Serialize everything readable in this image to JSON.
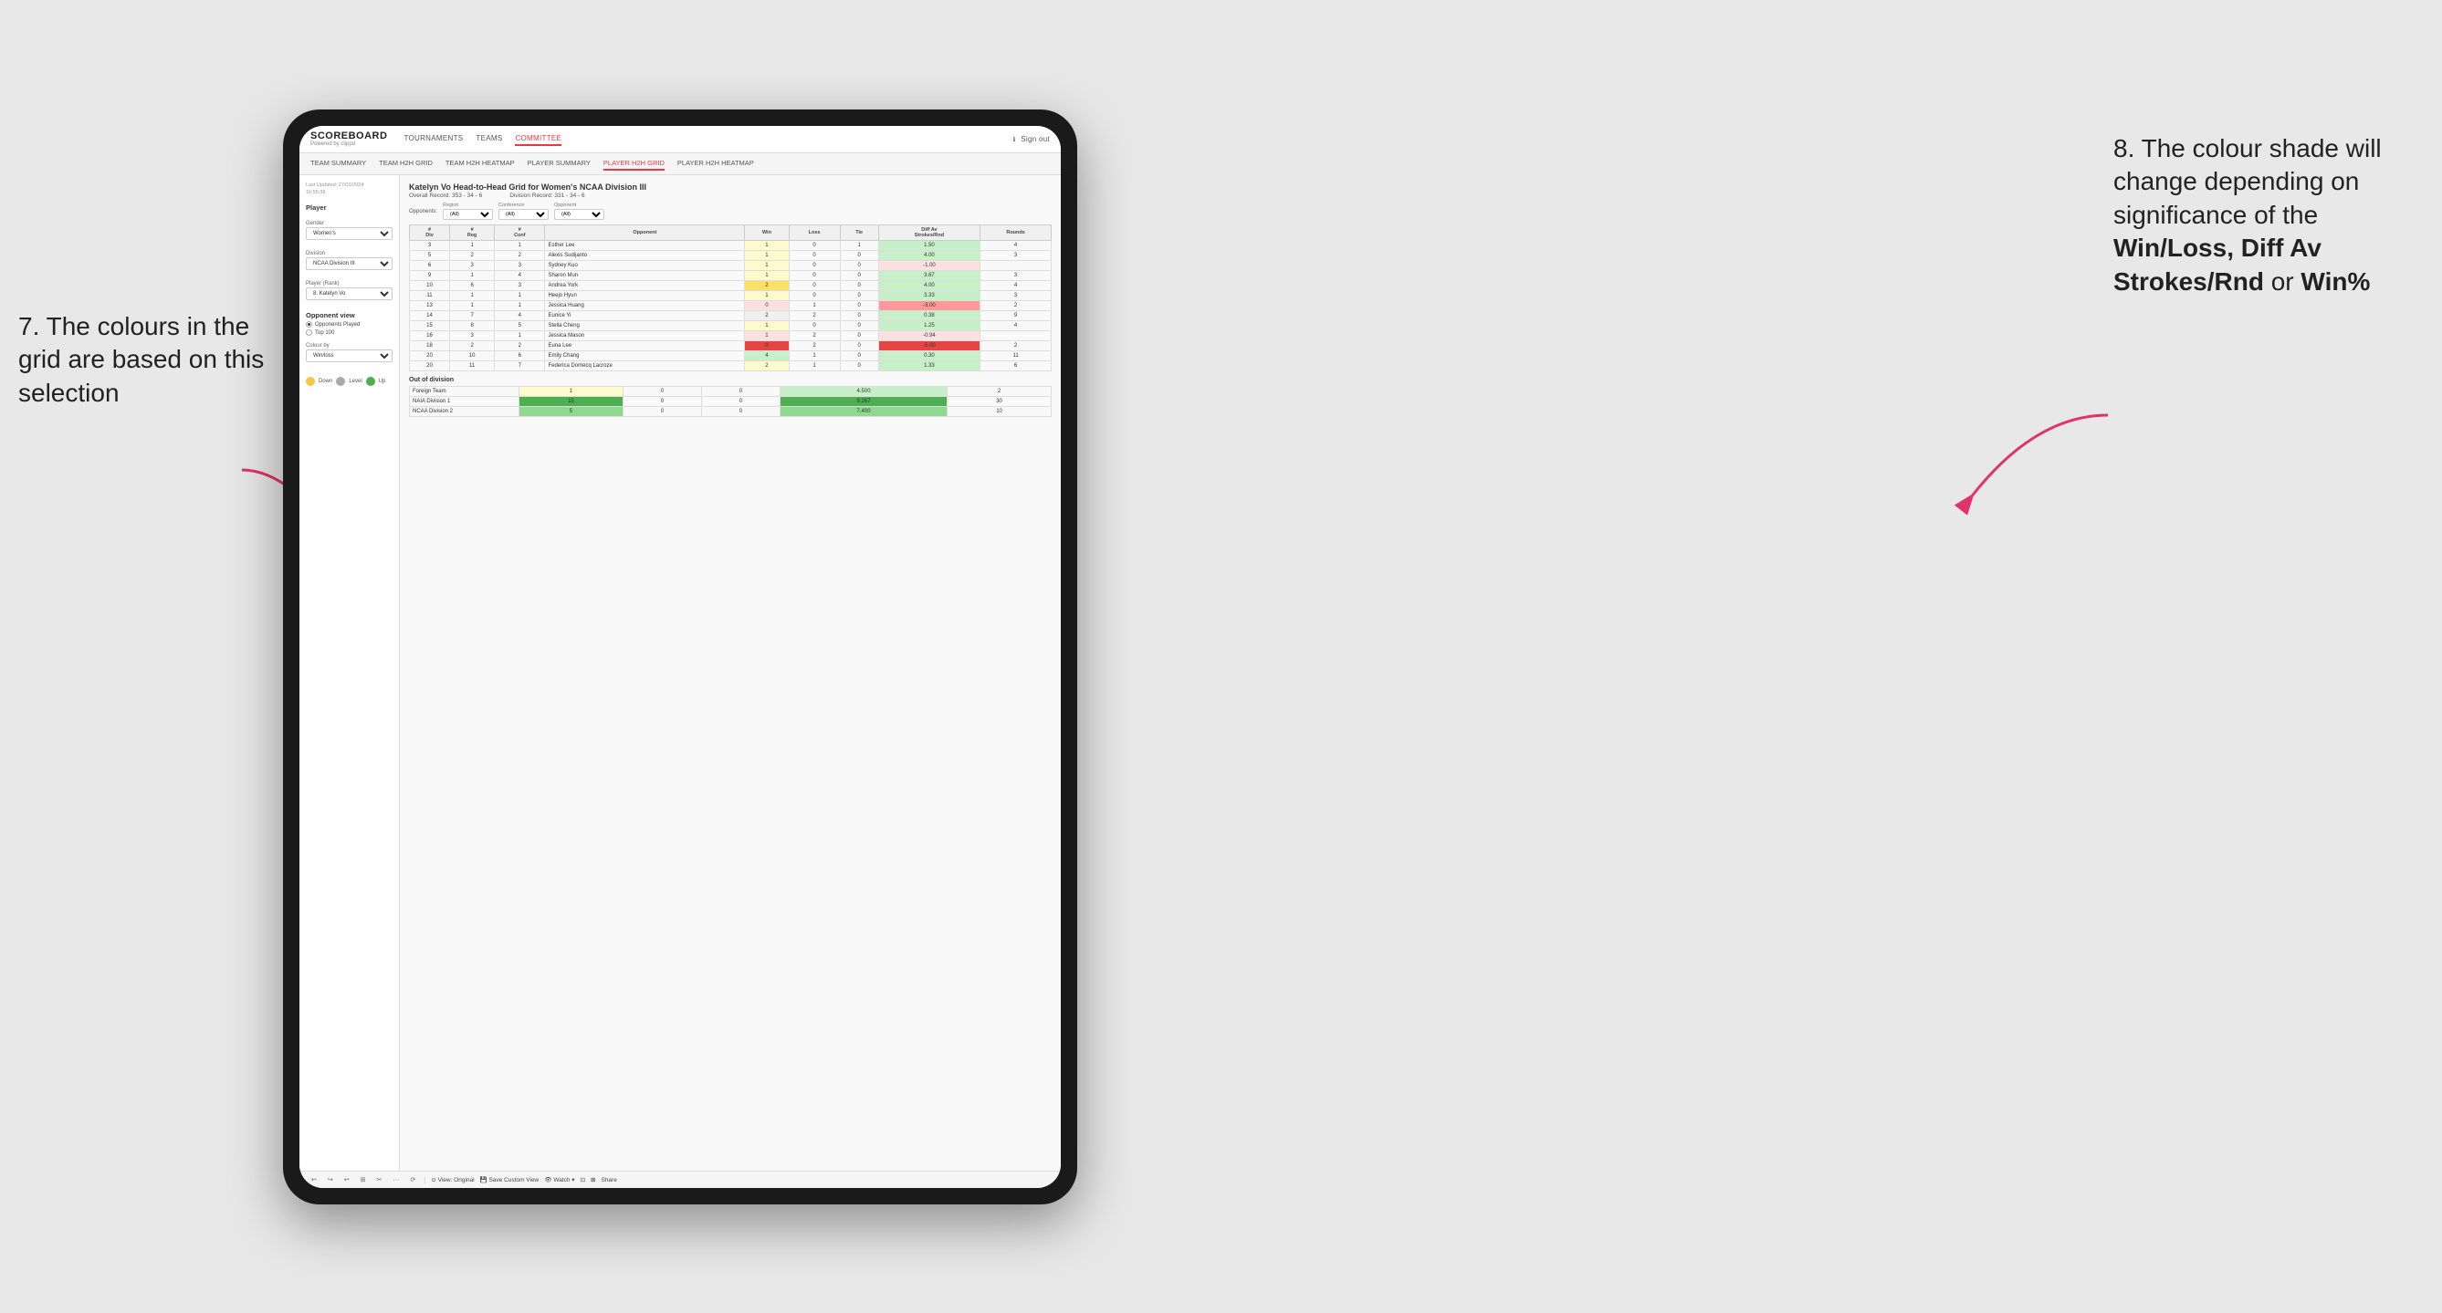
{
  "annotations": {
    "left_title": "7. The colours in the grid are based on this selection",
    "right_title": "8. The colour shade will change depending on significance of the",
    "right_bold1": "Win/Loss, Diff Av Strokes/Rnd",
    "right_text2": "or",
    "right_bold2": "Win%"
  },
  "nav": {
    "logo": "SCOREBOARD",
    "logo_sub": "Powered by clippd",
    "links": [
      "TOURNAMENTS",
      "TEAMS",
      "COMMITTEE"
    ],
    "active_link": "COMMITTEE",
    "right_links": [
      "Sign out"
    ]
  },
  "sub_nav": {
    "links": [
      "TEAM SUMMARY",
      "TEAM H2H GRID",
      "TEAM H2H HEATMAP",
      "PLAYER SUMMARY",
      "PLAYER H2H GRID",
      "PLAYER H2H HEATMAP"
    ],
    "active": "PLAYER H2H GRID"
  },
  "left_panel": {
    "last_updated_label": "Last Updated: 27/03/2024",
    "last_updated_time": "16:55:38",
    "player_section": "Player",
    "gender_label": "Gender",
    "gender_value": "Women's",
    "division_label": "Division",
    "division_value": "NCAA Division III",
    "player_rank_label": "Player (Rank)",
    "player_rank_value": "8. Katelyn Vo",
    "opponent_view_label": "Opponent view",
    "radio_options": [
      "Opponents Played",
      "Top 100"
    ],
    "radio_selected": "Opponents Played",
    "colour_by_label": "Colour by",
    "colour_by_value": "Win/loss",
    "legend_items": [
      {
        "color": "#f5c842",
        "label": "Down"
      },
      {
        "color": "#aaaaaa",
        "label": "Level"
      },
      {
        "color": "#4caf50",
        "label": "Up"
      }
    ]
  },
  "grid": {
    "title": "Katelyn Vo Head-to-Head Grid for Women's NCAA Division III",
    "overall_record_label": "Overall Record:",
    "overall_record": "353 - 34 - 6",
    "division_record_label": "Division Record:",
    "division_record": "331 - 34 - 6",
    "filter_region_label": "Region",
    "filter_region_value": "(All)",
    "filter_conference_label": "Conference",
    "filter_conference_value": "(All)",
    "filter_opponent_label": "Opponent",
    "filter_opponent_value": "(All)",
    "opponents_label": "Opponents:",
    "table_headers": [
      "#\nDiv",
      "#\nReg",
      "#\nConf",
      "Opponent",
      "Win",
      "Loss",
      "Tie",
      "Diff Av\nStrokes/Rnd",
      "Rounds"
    ],
    "rows": [
      {
        "div": "3",
        "reg": "1",
        "conf": "1",
        "opponent": "Esther Lee",
        "win": 1,
        "loss": 0,
        "tie": 1,
        "diff": "1.50",
        "rounds": "4",
        "win_color": "yellow-light",
        "diff_color": "green-light"
      },
      {
        "div": "5",
        "reg": "2",
        "conf": "2",
        "opponent": "Alexis Sudijanto",
        "win": 1,
        "loss": 0,
        "tie": 0,
        "diff": "4.00",
        "rounds": "3",
        "win_color": "yellow-light",
        "diff_color": "green-light"
      },
      {
        "div": "6",
        "reg": "3",
        "conf": "3",
        "opponent": "Sydney Kuo",
        "win": 1,
        "loss": 0,
        "tie": 0,
        "diff": "-1.00",
        "rounds": "",
        "win_color": "yellow-light",
        "diff_color": "red-light"
      },
      {
        "div": "9",
        "reg": "1",
        "conf": "4",
        "opponent": "Sharon Mun",
        "win": 1,
        "loss": 0,
        "tie": 0,
        "diff": "3.67",
        "rounds": "3",
        "win_color": "yellow-light",
        "diff_color": "green-light"
      },
      {
        "div": "10",
        "reg": "6",
        "conf": "3",
        "opponent": "Andrea York",
        "win": 2,
        "loss": 0,
        "tie": 0,
        "diff": "4.00",
        "rounds": "4",
        "win_color": "yellow-med",
        "diff_color": "green-light"
      },
      {
        "div": "11",
        "reg": "1",
        "conf": "1",
        "opponent": "Heejo Hyun",
        "win": 1,
        "loss": 0,
        "tie": 0,
        "diff": "3.33",
        "rounds": "3",
        "win_color": "yellow-light",
        "diff_color": "green-light"
      },
      {
        "div": "13",
        "reg": "1",
        "conf": "1",
        "opponent": "Jessica Huang",
        "win": 0,
        "loss": 1,
        "tie": 0,
        "diff": "-3.00",
        "rounds": "2",
        "win_color": "red-light",
        "diff_color": "red-med"
      },
      {
        "div": "14",
        "reg": "7",
        "conf": "4",
        "opponent": "Eunice Yi",
        "win": 2,
        "loss": 2,
        "tie": 0,
        "diff": "0.38",
        "rounds": "9",
        "win_color": "gray",
        "diff_color": "green-light"
      },
      {
        "div": "15",
        "reg": "8",
        "conf": "5",
        "opponent": "Stella Cheng",
        "win": 1,
        "loss": 0,
        "tie": 0,
        "diff": "1.25",
        "rounds": "4",
        "win_color": "yellow-light",
        "diff_color": "green-light"
      },
      {
        "div": "16",
        "reg": "3",
        "conf": "1",
        "opponent": "Jessica Mason",
        "win": 1,
        "loss": 2,
        "tie": 0,
        "diff": "-0.94",
        "rounds": "",
        "win_color": "red-light",
        "diff_color": "red-light"
      },
      {
        "div": "18",
        "reg": "2",
        "conf": "2",
        "opponent": "Euna Lee",
        "win": 0,
        "loss": 2,
        "tie": 0,
        "diff": "-5.00",
        "rounds": "2",
        "win_color": "red-dark",
        "diff_color": "red-dark"
      },
      {
        "div": "20",
        "reg": "10",
        "conf": "6",
        "opponent": "Emily Chang",
        "win": 4,
        "loss": 1,
        "tie": 0,
        "diff": "0.30",
        "rounds": "11",
        "win_color": "green-light",
        "diff_color": "green-light"
      },
      {
        "div": "20",
        "reg": "11",
        "conf": "7",
        "opponent": "Federica Domecq Lacroze",
        "win": 2,
        "loss": 1,
        "tie": 0,
        "diff": "1.33",
        "rounds": "6",
        "win_color": "yellow-light",
        "diff_color": "green-light"
      }
    ],
    "out_of_division_title": "Out of division",
    "out_of_div_rows": [
      {
        "name": "Foreign Team",
        "win": 1,
        "loss": 0,
        "tie": 0,
        "diff": "4.500",
        "rounds": "2",
        "win_color": "yellow-light",
        "diff_color": "green-light"
      },
      {
        "name": "NAIA Division 1",
        "win": 15,
        "loss": 0,
        "tie": 0,
        "diff": "9.267",
        "rounds": "30",
        "win_color": "green-dark",
        "diff_color": "green-dark"
      },
      {
        "name": "NCAA Division 2",
        "win": 5,
        "loss": 0,
        "tie": 0,
        "diff": "7.400",
        "rounds": "10",
        "win_color": "green-med",
        "diff_color": "green-med"
      }
    ]
  },
  "toolbar": {
    "buttons": [
      "↩",
      "↪",
      "↩",
      "⊞",
      "✂",
      "·",
      "⟳",
      "|",
      "View: Original",
      "Save Custom View",
      "Watch ▾",
      "⊡",
      "⊠",
      "Share"
    ]
  }
}
